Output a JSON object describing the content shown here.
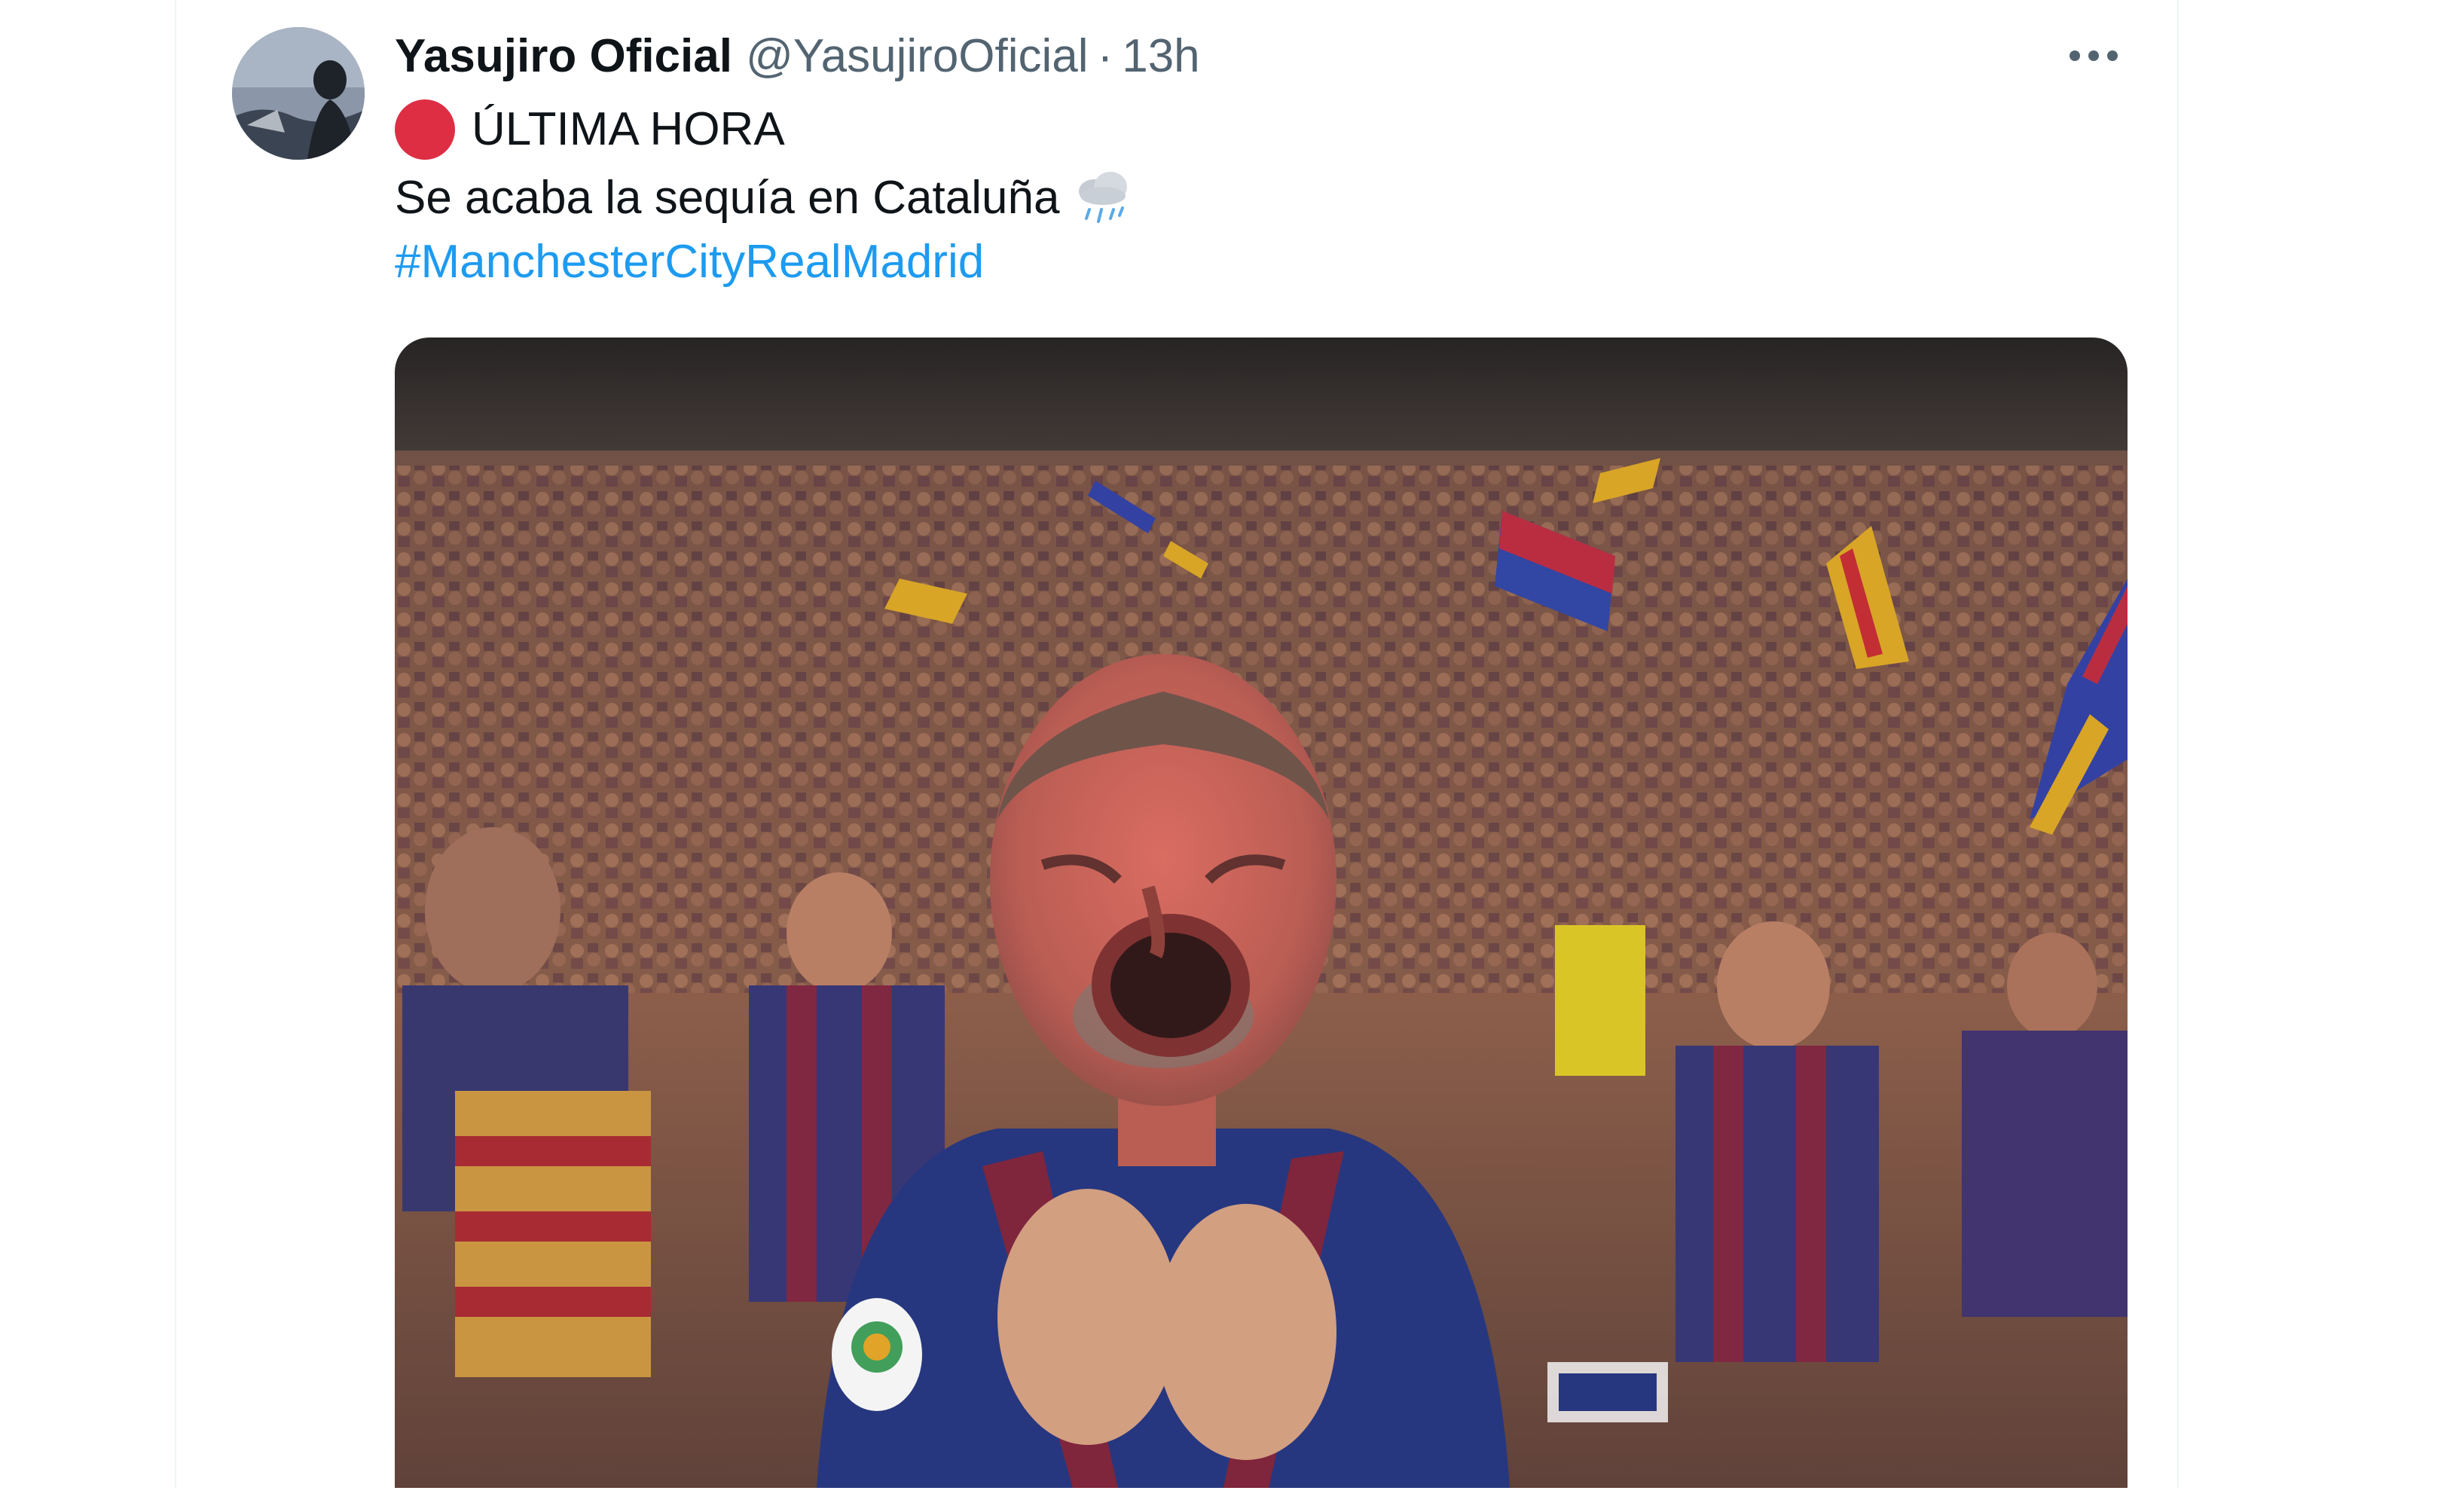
{
  "tweet": {
    "author": {
      "display_name": "Yasujiro Oficial",
      "handle": "@YasujiroOficial",
      "separator": "·",
      "timestamp": "13h"
    },
    "menu_icon": "more-horizontal-icon",
    "text": {
      "line1_icon": "red-circle-emoji",
      "line1": "ÚLTIMA HORA",
      "line2": "Se acaba la sequía en Cataluña",
      "line2_icon": "cloud-with-rain-emoji",
      "hashtag": "#ManchesterCityRealMadrid"
    },
    "media": {
      "kind": "photo",
      "subject": "crying football fan in a stadium crowd"
    }
  },
  "colors": {
    "text_primary": "#0f1419",
    "text_secondary": "#536471",
    "link": "#1d9bf0",
    "red_circle": "#dd2e44",
    "border": "#eff3f4"
  }
}
